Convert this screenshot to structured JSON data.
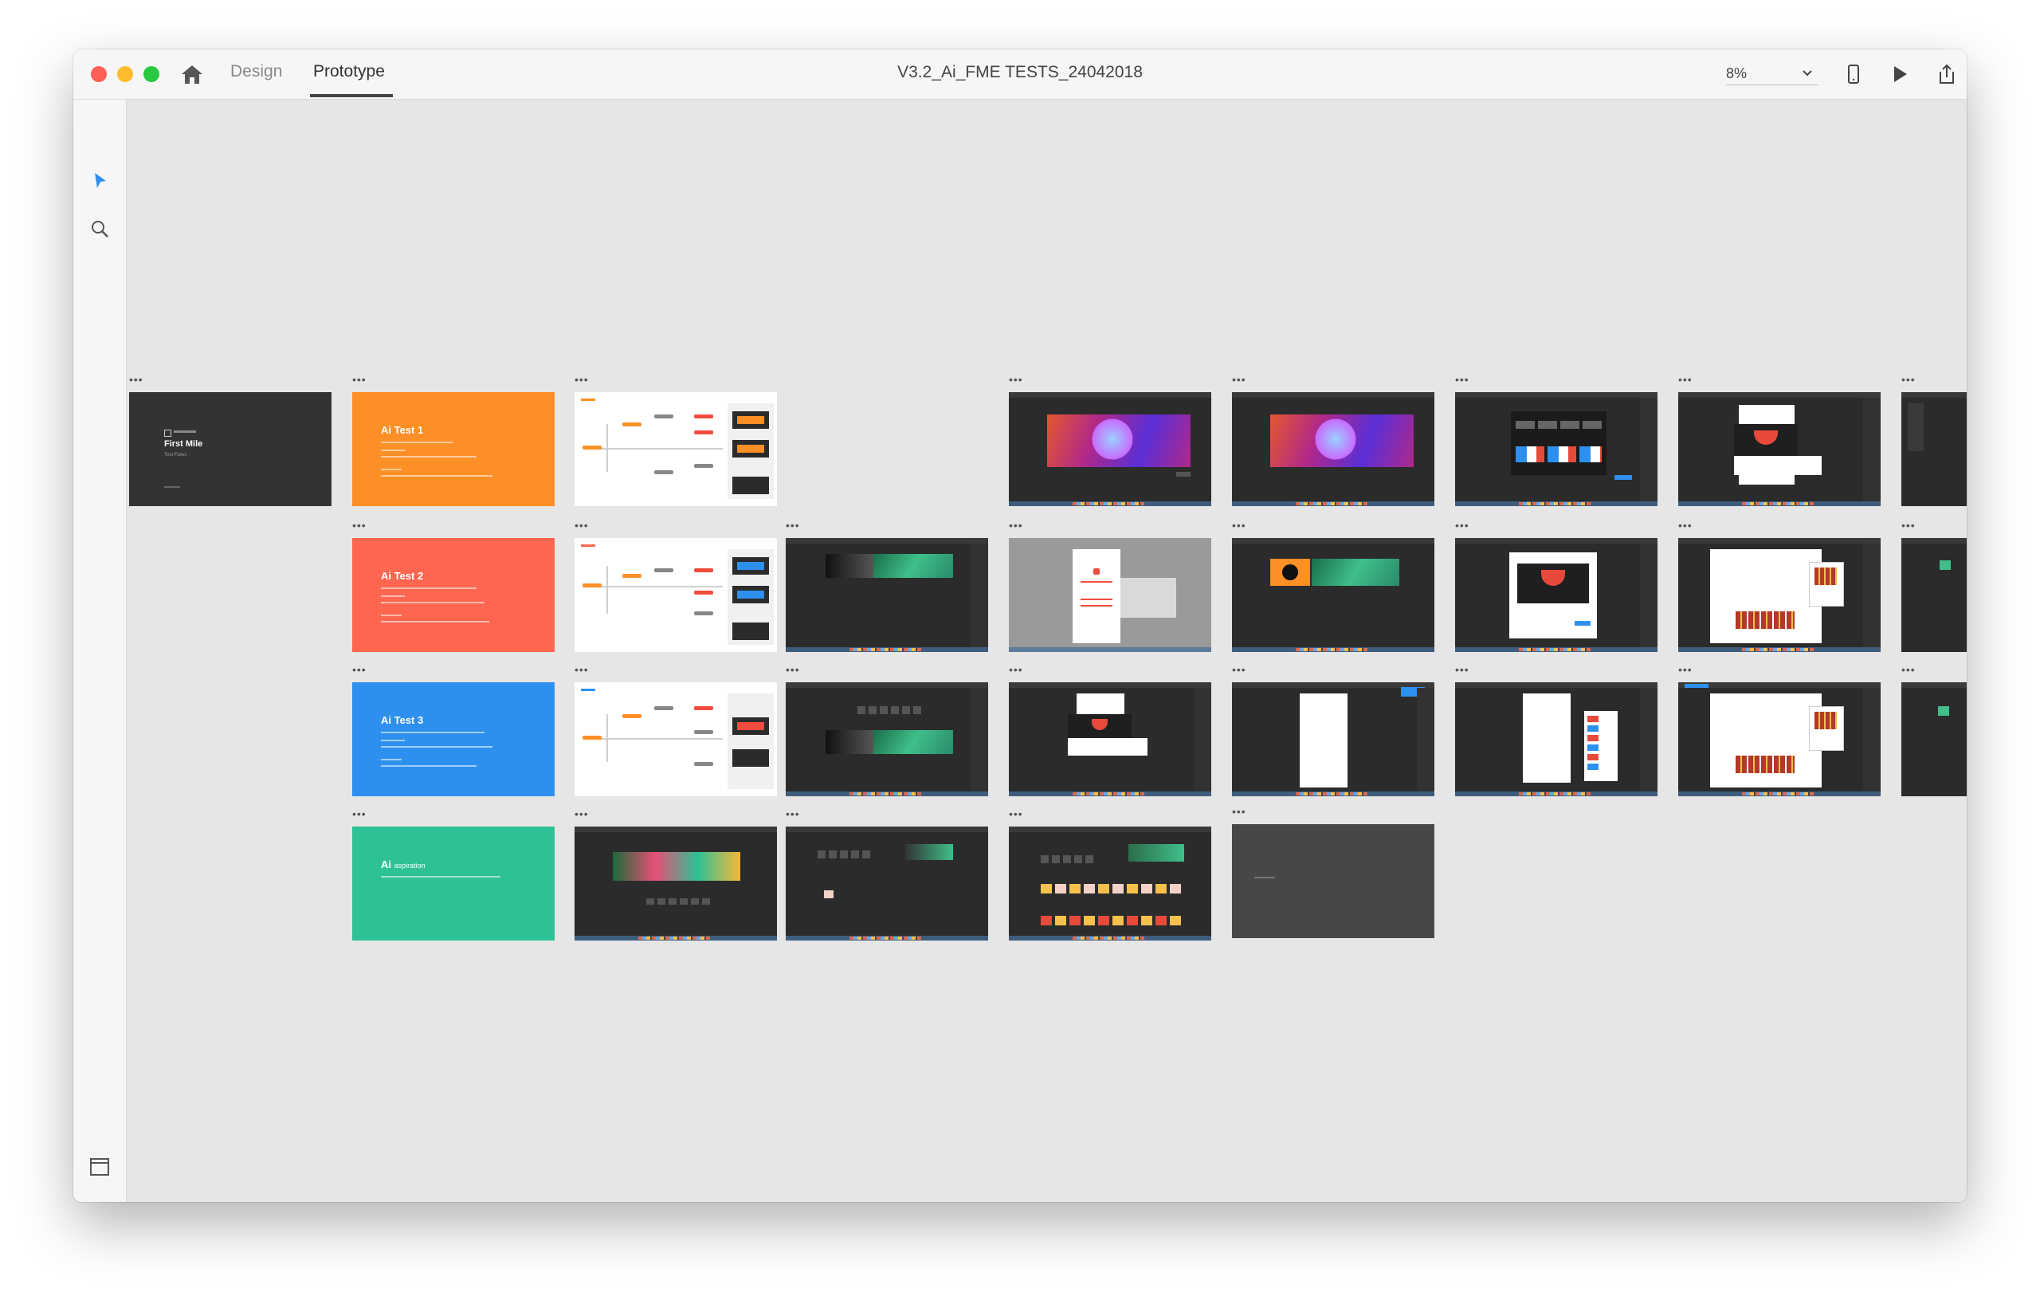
{
  "window": {
    "doc_title": "V3.2_Ai_FME TESTS_24042018",
    "tabs": [
      {
        "label": "Design",
        "active": false
      },
      {
        "label": "Prototype",
        "active": true
      }
    ],
    "zoom": "8%",
    "toolbar_right_icons": [
      "device-preview-icon",
      "play-icon",
      "share-icon"
    ]
  },
  "left_toolbar": {
    "top_tools": [
      "select-arrow-icon",
      "search-icon"
    ],
    "bottom_tools": [
      "artboard-icon",
      "layers-icon"
    ]
  },
  "colors": {
    "orange": "#fc8f26",
    "coral": "#fe6650",
    "blue": "#2e90ee",
    "green": "#2fc196",
    "dark": "#333333",
    "selection": "#2e90ee"
  },
  "artboards": {
    "cover": {
      "title": "First Mile",
      "subtitle": "Test Flows"
    },
    "test1": {
      "title": "Ai Test 1"
    },
    "test2": {
      "title": "Ai Test 2"
    },
    "test3": {
      "title": "Ai Test 3"
    },
    "aspiration": {
      "title": "Ai",
      "subtitle": "aspiration"
    }
  }
}
